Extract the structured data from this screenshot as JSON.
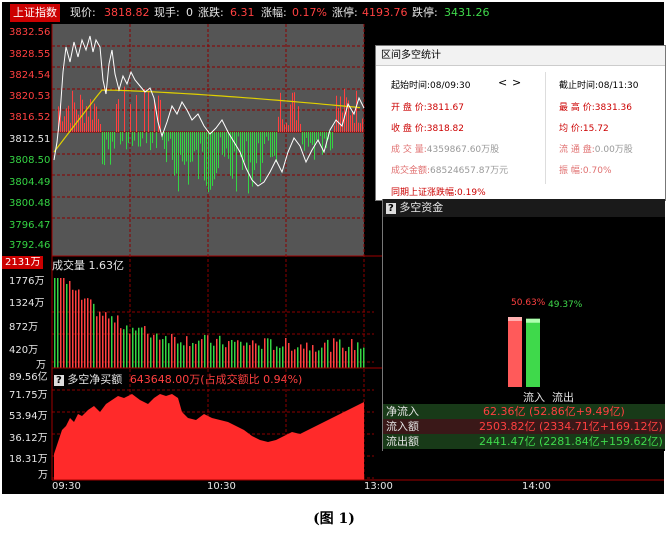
{
  "header": {
    "index_name": "上证指数",
    "price_label": "现价:",
    "price": "3818.82",
    "hand_label": "现手:",
    "hand": "0",
    "change_label": "涨跌:",
    "change": "6.31",
    "pct_label": "涨幅:",
    "pct": "0.17%",
    "limit_up_label": "涨停:",
    "limit_up": "4193.76",
    "limit_down_label": "跌停:",
    "limit_down": "3431.26"
  },
  "price_axis": {
    "red_ticks": [
      "3832.56",
      "3828.55",
      "3824.54",
      "3820.53",
      "3816.52"
    ],
    "mid_tick": "3812.51",
    "green_ticks": [
      "3808.50",
      "3804.49",
      "3800.48",
      "3796.47",
      "3792.46"
    ]
  },
  "volume": {
    "title": "成交量 1.63亿",
    "max_tick": "2131万",
    "ticks": [
      "1776万",
      "1324万",
      "872万",
      "420万",
      "万"
    ]
  },
  "net_buy": {
    "title": "多空净买额",
    "value_text": "643648.00万(占成交额比 0.94%)",
    "ticks": [
      "89.56亿",
      "71.75万",
      "53.94万",
      "36.12万",
      "18.31万",
      "万"
    ]
  },
  "time_axis": [
    "09:30",
    "10:30",
    "13:00",
    "14:00"
  ],
  "stats_panel": {
    "title": "区间多空统计",
    "start_label": "起始时间:",
    "start_time": "08/09:30",
    "prev_symbol": "<",
    "next_symbol": ">",
    "end_label": "截止时间:",
    "end_time": "08/11:30",
    "open_label": "开 盘 价:",
    "open_value": "3811.67",
    "high_label": "最 高 价:",
    "high_value": "3831.36",
    "close_label": "收 盘 价:",
    "close_value": "3818.82",
    "avg_label": "均    价:",
    "avg_value": "15.72",
    "volume_label": "成 交 量:",
    "volume_value": "4359867.60万股",
    "float_label": "流 通 盘:",
    "float_value": "0.00万股",
    "amount_label": "成交金额:",
    "amount_value": "68524657.87万元",
    "amplitude_label": "振    幅:",
    "amplitude_value": "0.70%",
    "period_label": "同期上证涨跌幅:",
    "period_value": "0.19%"
  },
  "fund_panel": {
    "title": "多空资金",
    "inflow_pct": "50.63%",
    "outflow_pct": "49.37%",
    "inflow_ratio": 0.5063,
    "outflow_ratio": 0.4937,
    "inflow_bar_label": "流入",
    "outflow_bar_label": "流出",
    "rows": [
      {
        "label": "净流入",
        "value": "62.36亿 (52.86亿+9.49亿)"
      },
      {
        "label": "流入额",
        "value": "2503.82亿 (2334.71亿+169.12亿)"
      },
      {
        "label": "流出额",
        "value": "2441.47亿 (2281.84亿+159.62亿)"
      }
    ]
  },
  "caption": "(图 1)",
  "colors": {
    "background": "#000000",
    "up": "#ff4040",
    "down": "#3fd94b",
    "grid": "#8b0000",
    "price_panel_bg": "#555555",
    "avg_line": "#e0d000",
    "net_buy_fill": "#ff2a2a"
  }
}
